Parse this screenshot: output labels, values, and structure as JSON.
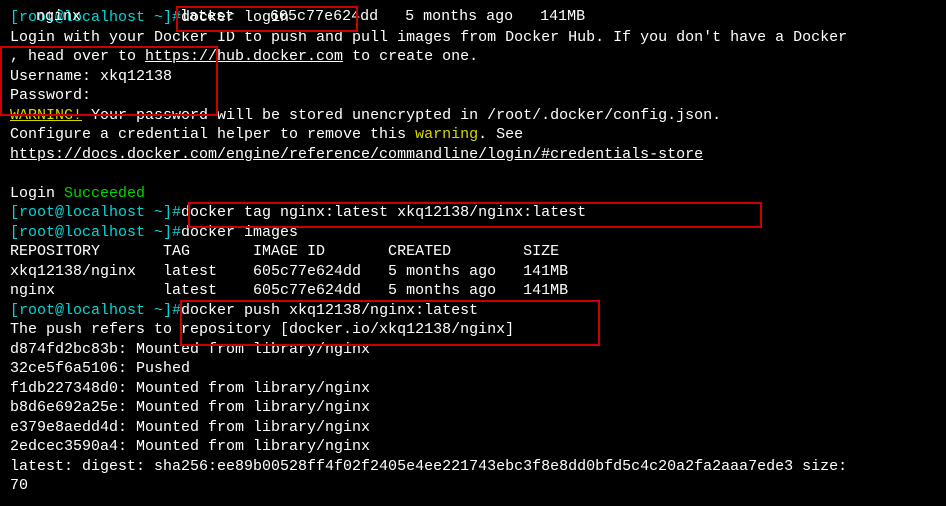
{
  "lines": {
    "l00": "nginx           latest    605c77e624dd   5 months ago   141MB",
    "l01p": "[root@localhost ~]#",
    "l01c": "docker login",
    "l02": "Login with your Docker ID to push and pull images from Docker Hub. If you don't have a Docker",
    "l03a": ", head over to ",
    "l03b": "https://hub.docker.com",
    "l03c": " to create one.",
    "l04": "Username: xkq12138",
    "l05": "Password:",
    "l06a": "WARNING!",
    "l06b": " Your password will be stored unencrypted in /root/.docker/config.json.",
    "l07a": "Configure a credential helper to remove this ",
    "l07b": "warning",
    "l07c": ". See",
    "l08": "https://docs.docker.com/engine/reference/commandline/login/#credentials-store",
    "l09": "",
    "l10a": "Login ",
    "l10b": "Succeeded",
    "l11p": "[root@localhost ~]#",
    "l11c": "docker tag nginx:latest xkq12138/nginx:latest",
    "l12p": "[root@localhost ~]#",
    "l12c": "docker images",
    "l13": "REPOSITORY       TAG       IMAGE ID       CREATED        SIZE",
    "l14": "xkq12138/nginx   latest    605c77e624dd   5 months ago   141MB",
    "l15": "nginx            latest    605c77e624dd   5 months ago   141MB",
    "l16p": "[root@localhost ~]#",
    "l16c": "docker push xkq12138/nginx:latest",
    "l17": "The push refers to repository [docker.io/xkq12138/nginx]",
    "l18": "d874fd2bc83b: Mounted from library/nginx",
    "l19": "32ce5f6a5106: Pushed",
    "l20": "f1db227348d0: Mounted from library/nginx",
    "l21": "b8d6e692a25e: Mounted from library/nginx",
    "l22": "e379e8aedd4d: Mounted from library/nginx",
    "l23": "2edcec3590a4: Mounted from library/nginx",
    "l24": "latest: digest: sha256:ee89b00528ff4f02f2405e4ee221743ebc3f8e8dd0bfd5c4c20a2fa2aaa7ede3 size:",
    "l25": "70"
  }
}
